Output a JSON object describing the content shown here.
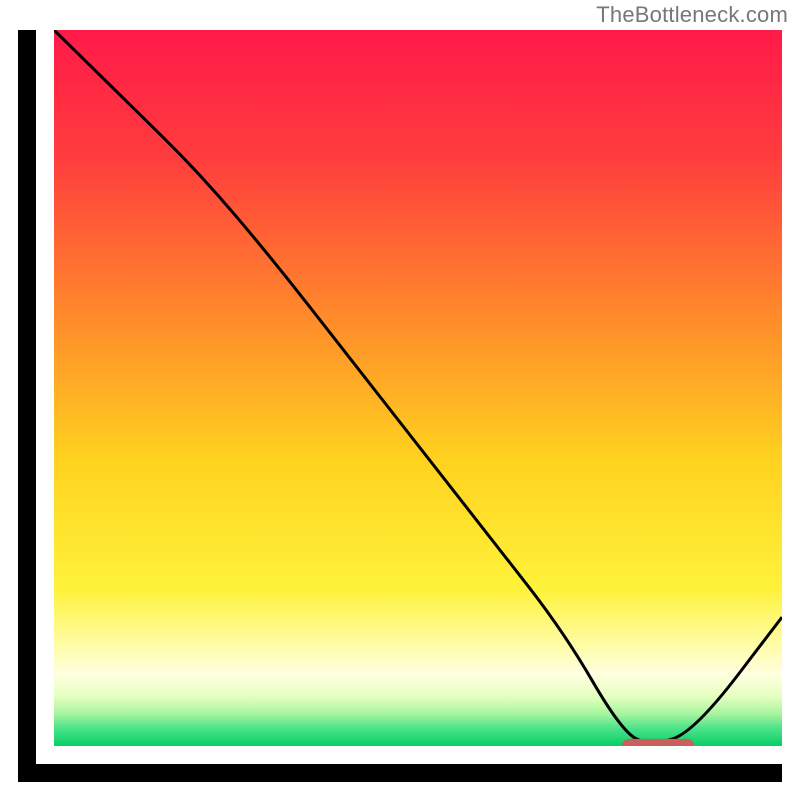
{
  "attribution": "TheBottleneck.com",
  "chart_data": {
    "type": "line",
    "title": "",
    "xlabel": "",
    "ylabel": "",
    "xlim": [
      0,
      100
    ],
    "ylim": [
      0,
      100
    ],
    "x": [
      0,
      10,
      20,
      30,
      40,
      50,
      60,
      70,
      78,
      82,
      88,
      100
    ],
    "values": [
      100,
      90,
      80,
      68,
      55,
      42,
      29,
      16,
      2,
      0,
      2,
      18
    ],
    "marker_segment": {
      "x_start": 78,
      "x_end": 88,
      "y": 0
    },
    "gradient_stops": [
      {
        "pos": 0.0,
        "color": "#ff1a49"
      },
      {
        "pos": 0.18,
        "color": "#ff3d3d"
      },
      {
        "pos": 0.4,
        "color": "#ff8a2b"
      },
      {
        "pos": 0.6,
        "color": "#ffd21f"
      },
      {
        "pos": 0.78,
        "color": "#fff23a"
      },
      {
        "pos": 0.86,
        "color": "#fffca8"
      },
      {
        "pos": 0.9,
        "color": "#ffffe0"
      },
      {
        "pos": 0.93,
        "color": "#e6ffc0"
      },
      {
        "pos": 0.955,
        "color": "#a8f5a0"
      },
      {
        "pos": 0.975,
        "color": "#4de38a"
      },
      {
        "pos": 1.0,
        "color": "#06cf68"
      }
    ],
    "marker_color": "#c9605d",
    "curve_color": "#000000",
    "curve_width": 3
  }
}
